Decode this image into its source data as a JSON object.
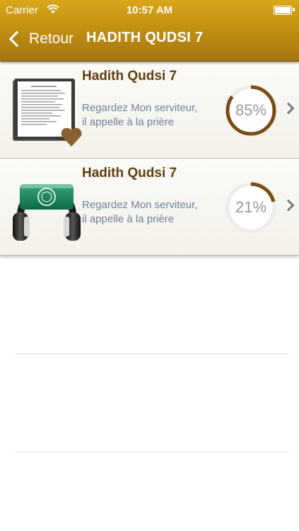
{
  "status_bar": {
    "carrier": "Carrier",
    "time": "10:57 AM",
    "icons": [
      "wifi-icon",
      "battery-icon"
    ]
  },
  "nav": {
    "back_label": "Retour",
    "title": "HADITH QUDSI 7",
    "bar_color": "#c3910f"
  },
  "items": [
    {
      "title": "Hadith Qudsi 7",
      "subtitle_line1": "Regardez Mon serviteur,",
      "subtitle_line2": "il appelle à la prière",
      "progress_label": "85%",
      "progress": 0.85,
      "icon": "document-icon",
      "badge": "heart-icon"
    },
    {
      "title": "Hadith Qudsi 7",
      "subtitle_line1": "Regardez Mon serviteur,",
      "subtitle_line2": "il appelle à la prière",
      "progress_label": "21%",
      "progress": 0.21,
      "icon": "headphones-icon"
    }
  ],
  "colors": {
    "title_text": "#5e3f10",
    "subtitle_text": "#6d8296",
    "progress_fill": "#7a4c18",
    "heart": "#8b6131"
  }
}
